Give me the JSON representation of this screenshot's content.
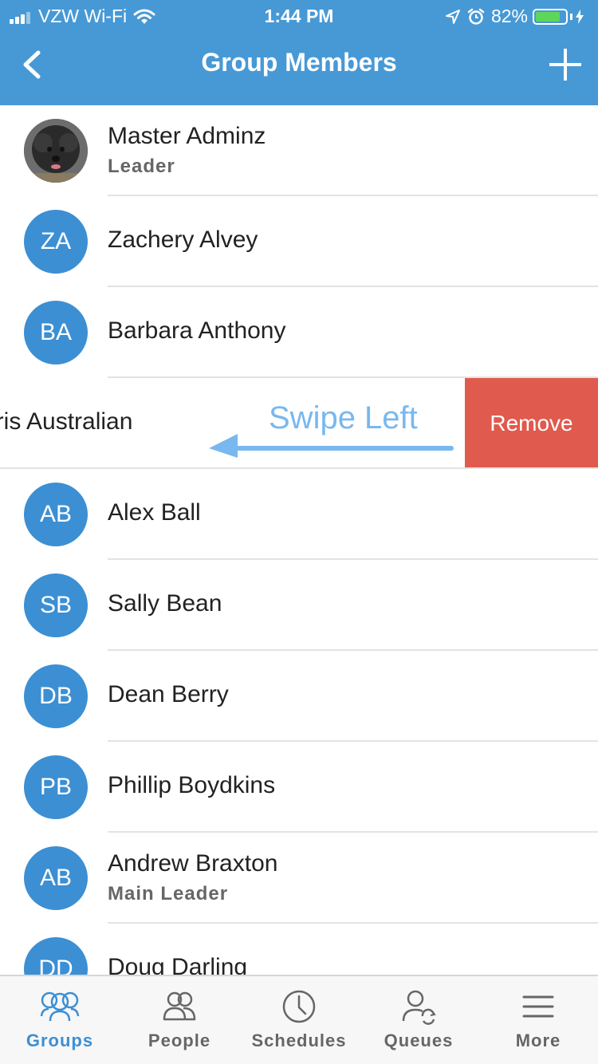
{
  "status_bar": {
    "carrier": "VZW Wi-Fi",
    "time": "1:44 PM",
    "battery_percent": "82%",
    "battery_level": 0.82
  },
  "nav": {
    "title": "Group Members",
    "back_icon": "chevron-left-icon",
    "add_icon": "plus-icon"
  },
  "members": [
    {
      "name": "Master Adminz",
      "role": "Leader",
      "photo": true
    },
    {
      "name": "Zachery Alvey",
      "initials": "ZA"
    },
    {
      "name": "Barbara Anthony",
      "initials": "BA"
    },
    {
      "name": "hris Australian",
      "swiped": true
    },
    {
      "name": "Alex Ball",
      "initials": "AB"
    },
    {
      "name": "Sally Bean",
      "initials": "SB"
    },
    {
      "name": "Dean Berry",
      "initials": "DB"
    },
    {
      "name": "Phillip Boydkins",
      "initials": "PB"
    },
    {
      "name": "Andrew Braxton",
      "initials": "AB",
      "role": "Main Leader"
    },
    {
      "name": "Doug Darling",
      "initials": "DD"
    }
  ],
  "swipe": {
    "hint": "Swipe Left",
    "action_label": "Remove",
    "action_color": "#e05a4d"
  },
  "tabs": [
    {
      "label": "Groups",
      "icon": "groups-icon",
      "active": true
    },
    {
      "label": "People",
      "icon": "people-icon"
    },
    {
      "label": "Schedules",
      "icon": "clock-icon"
    },
    {
      "label": "Queues",
      "icon": "queues-icon"
    },
    {
      "label": "More",
      "icon": "menu-icon"
    }
  ],
  "colors": {
    "header": "#4799d6",
    "avatar": "#3c8fd3",
    "hint": "#78b8ef",
    "active_tab": "#3c8fd3"
  }
}
